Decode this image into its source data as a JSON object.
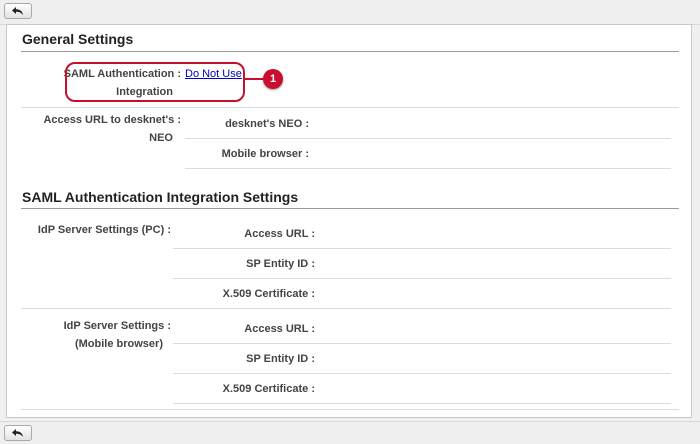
{
  "toolbar": {
    "back_icon": "back-arrow-icon"
  },
  "general": {
    "title": "General Settings",
    "saml_label_line1": "SAML Authentication",
    "saml_label_line2": "Integration",
    "saml_value": "Do Not Use",
    "access_label_line1": "Access URL to desknet's",
    "access_label_line2": "NEO",
    "access_neo_label": "desknet's NEO",
    "access_mobile_label": "Mobile browser"
  },
  "annotation": {
    "number": "1",
    "color": "#c8102e"
  },
  "saml": {
    "title": "SAML Authentication Integration Settings",
    "pc_label": "IdP Server Settings (PC)",
    "mobile_label_line1": "IdP Server Settings",
    "mobile_label_line2": "(Mobile browser)",
    "fields": {
      "access_url": "Access URL",
      "sp_entity_id": "SP Entity ID",
      "x509": "X.509 Certificate"
    }
  }
}
